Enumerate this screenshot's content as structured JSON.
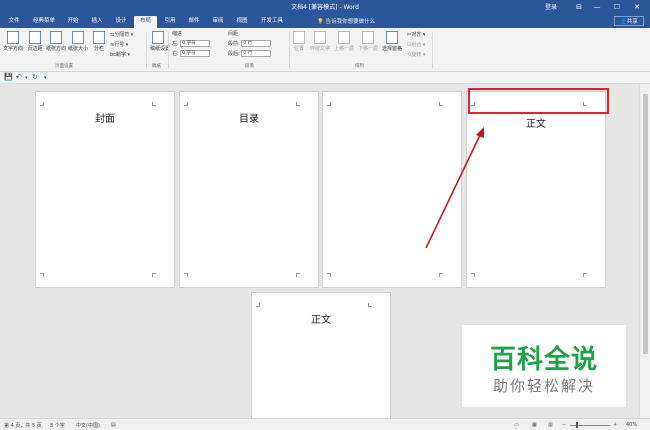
{
  "window": {
    "title": "文档4 [兼容模式] - Word",
    "signin": "登录",
    "controls": [
      "⊟",
      "—",
      "☐",
      "✕"
    ]
  },
  "tabs": [
    "文件",
    "经典菜单",
    "开始",
    "插入",
    "设计",
    "布局",
    "引用",
    "邮件",
    "审阅",
    "视图",
    "开发工具"
  ],
  "active_tab": "布局",
  "tell_me": "告诉我你想要做什么",
  "share": "共享",
  "ribbon": {
    "buttons": [
      "文字方向",
      "页边距",
      "纸张方向",
      "纸张大小",
      "分栏"
    ],
    "page_setup_small": [
      "分隔符",
      "行号",
      "断字"
    ],
    "page_setup_label": "页面设置",
    "draft": "稿纸设置",
    "draft_label": "稿纸",
    "indent_title": "缩进",
    "indent_left_label": "左:",
    "indent_left": "0 字符",
    "indent_right_label": "右:",
    "indent_right": "0 字符",
    "spacing_title": "间距",
    "spacing_before_label": "段前:",
    "spacing_before": "0 行",
    "spacing_after_label": "段后:",
    "spacing_after": "0 行",
    "paragraph_label": "段落",
    "arrange_buttons": [
      "位置",
      "环绕文字",
      "上移一层",
      "下移一层",
      "选择窗格"
    ],
    "arrange_small": [
      "对齐",
      "组合",
      "旋转"
    ],
    "arrange_label": "排列"
  },
  "pages": {
    "p1": "封面",
    "p2": "目录",
    "p3": "",
    "p4": "正文",
    "p5": "正文"
  },
  "watermark": {
    "title": "百科全说",
    "subtitle": "助你轻松解决"
  },
  "status": {
    "pages": "第 4 页，共 5 页",
    "words": "8 个字",
    "lang": "中文(中国)",
    "zoom": "40%"
  },
  "colors": {
    "brand": "#2b579a",
    "highlight_box": "#e0222a",
    "arrow": "#c0141c",
    "watermark_green": "#1fa14a"
  }
}
